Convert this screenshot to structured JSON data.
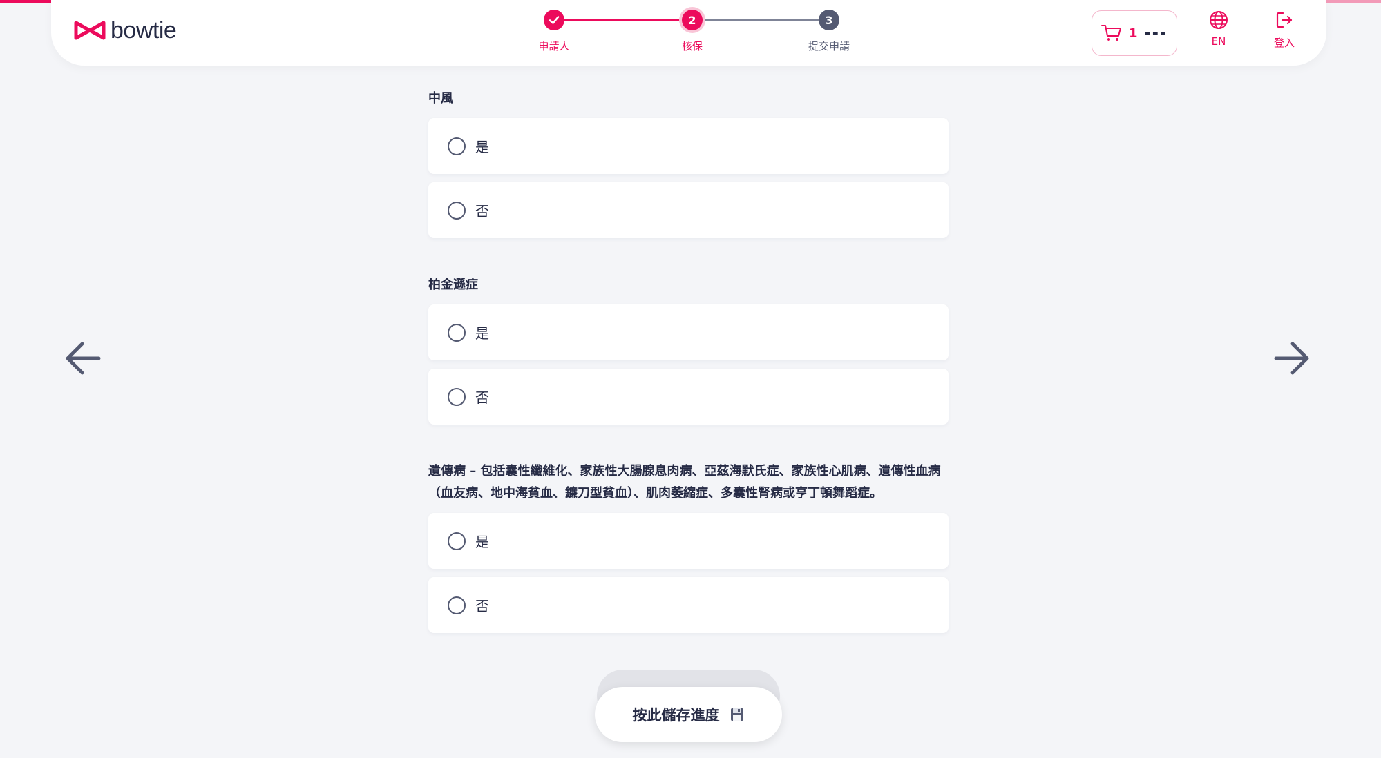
{
  "colors": {
    "accent": "#ec0b5c",
    "navy": "#262b45",
    "grey": "#545a72",
    "background": "#f4f5f8"
  },
  "header": {
    "logo_text": "bowtie",
    "steps": [
      {
        "number": "",
        "label": "申請人",
        "state": "done"
      },
      {
        "number": "2",
        "label": "核保",
        "state": "current"
      },
      {
        "number": "3",
        "label": "提交申請",
        "state": "pending"
      }
    ],
    "cart": {
      "count": "1",
      "price": "---"
    },
    "language_label": "EN",
    "login_label": "登入"
  },
  "questions": [
    {
      "title": "中風",
      "options": [
        "是",
        "否"
      ]
    },
    {
      "title": "柏金遜症",
      "options": [
        "是",
        "否"
      ]
    },
    {
      "title": "遺傳病 – 包括囊性纖維化、家族性大腸腺息肉病、亞茲海默氏症、家族性心肌病、遺傳性血病（血友病、地中海貧血、鐮刀型貧血）、肌肉萎縮症、多囊性腎病或亨丁頓舞蹈症。",
      "options": [
        "是",
        "否"
      ]
    }
  ],
  "footer": {
    "save_label": "按此儲存進度"
  }
}
